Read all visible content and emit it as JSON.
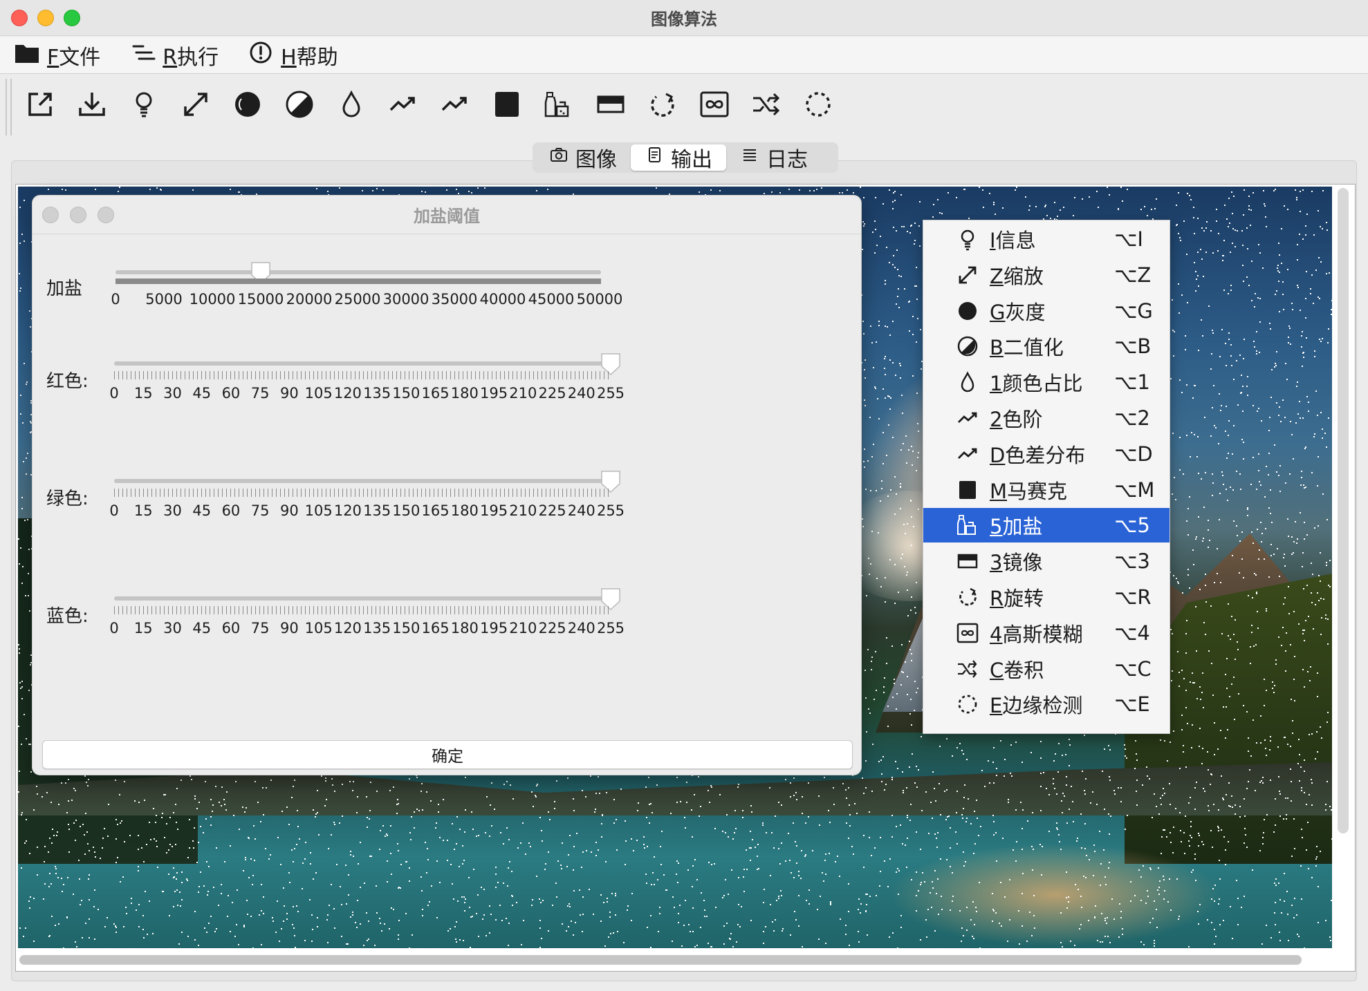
{
  "window": {
    "title": "图像算法"
  },
  "menubar": [
    {
      "mnemonic": "F",
      "label": "文件",
      "icon": "folder-icon"
    },
    {
      "mnemonic": "R",
      "label": "执行",
      "icon": "list-run-icon"
    },
    {
      "mnemonic": "H",
      "label": "帮助",
      "icon": "help-icon"
    }
  ],
  "toolbar": [
    "export-icon",
    "download-icon",
    "lightbulb-info-icon",
    "zoom-icon",
    "grayscale-icon",
    "binarize-icon",
    "droplet-icon",
    "levels-icon",
    "color-diff-icon",
    "mosaic-icon",
    "salt-icon",
    "mirror-icon",
    "rotate-icon",
    "gaussian-blur-icon",
    "convolution-icon",
    "edge-detect-icon"
  ],
  "tabs": [
    {
      "label": "图像",
      "icon": "camera-icon",
      "active": false
    },
    {
      "label": "输出",
      "icon": "document-icon",
      "active": true
    },
    {
      "label": "日志",
      "icon": "list-icon",
      "active": false
    }
  ],
  "dialog": {
    "title": "加盐阈值",
    "sliders": [
      {
        "label": "加盐",
        "value": 15000,
        "min": 0,
        "max": 50000,
        "ticks": [
          "0",
          "5000",
          "10000",
          "15000",
          "20000",
          "25000",
          "30000",
          "35000",
          "40000",
          "45000",
          "50000"
        ]
      },
      {
        "label": "红色:",
        "value": 255,
        "min": 0,
        "max": 255,
        "ticks": [
          "0",
          "15",
          "30",
          "45",
          "60",
          "75",
          "90",
          "105",
          "120",
          "135",
          "150",
          "165",
          "180",
          "195",
          "210",
          "225",
          "240",
          "255"
        ]
      },
      {
        "label": "绿色:",
        "value": 255,
        "min": 0,
        "max": 255,
        "ticks": [
          "0",
          "15",
          "30",
          "45",
          "60",
          "75",
          "90",
          "105",
          "120",
          "135",
          "150",
          "165",
          "180",
          "195",
          "210",
          "225",
          "240",
          "255"
        ]
      },
      {
        "label": "蓝色:",
        "value": 255,
        "min": 0,
        "max": 255,
        "ticks": [
          "0",
          "15",
          "30",
          "45",
          "60",
          "75",
          "90",
          "105",
          "120",
          "135",
          "150",
          "165",
          "180",
          "195",
          "210",
          "225",
          "240",
          "255"
        ]
      }
    ],
    "confirm_label": "确定"
  },
  "context_menu": {
    "items": [
      {
        "mnemonic": "I",
        "label": "信息",
        "shortcut": "⌥I",
        "icon": "lightbulb-info-icon",
        "selected": false
      },
      {
        "mnemonic": "Z",
        "label": "缩放",
        "shortcut": "⌥Z",
        "icon": "zoom-icon",
        "selected": false
      },
      {
        "mnemonic": "G",
        "label": "灰度",
        "shortcut": "⌥G",
        "icon": "grayscale-icon",
        "selected": false
      },
      {
        "mnemonic": "B",
        "label": "二值化",
        "shortcut": "⌥B",
        "icon": "binarize-icon",
        "selected": false
      },
      {
        "mnemonic": "1",
        "label": "颜色占比",
        "shortcut": "⌥1",
        "icon": "droplet-icon",
        "selected": false
      },
      {
        "mnemonic": "2",
        "label": "色阶",
        "shortcut": "⌥2",
        "icon": "levels-icon",
        "selected": false
      },
      {
        "mnemonic": "D",
        "label": "色差分布",
        "shortcut": "⌥D",
        "icon": "color-diff-icon",
        "selected": false
      },
      {
        "mnemonic": "M",
        "label": "马赛克",
        "shortcut": "⌥M",
        "icon": "mosaic-icon",
        "selected": false
      },
      {
        "mnemonic": "5",
        "label": "加盐",
        "shortcut": "⌥5",
        "icon": "salt-icon",
        "selected": true
      },
      {
        "mnemonic": "3",
        "label": "镜像",
        "shortcut": "⌥3",
        "icon": "mirror-icon",
        "selected": false
      },
      {
        "mnemonic": "R",
        "label": "旋转",
        "shortcut": "⌥R",
        "icon": "rotate-icon",
        "selected": false
      },
      {
        "mnemonic": "4",
        "label": "高斯模糊",
        "shortcut": "⌥4",
        "icon": "gaussian-blur-icon",
        "selected": false
      },
      {
        "mnemonic": "C",
        "label": "卷积",
        "shortcut": "⌥C",
        "icon": "convolution-icon",
        "selected": false
      },
      {
        "mnemonic": "E",
        "label": "边缘检测",
        "shortcut": "⌥E",
        "icon": "edge-detect-icon",
        "selected": false
      }
    ]
  },
  "colors": {
    "selection": "#2a63d6",
    "salt_noise": "#ffffff"
  }
}
